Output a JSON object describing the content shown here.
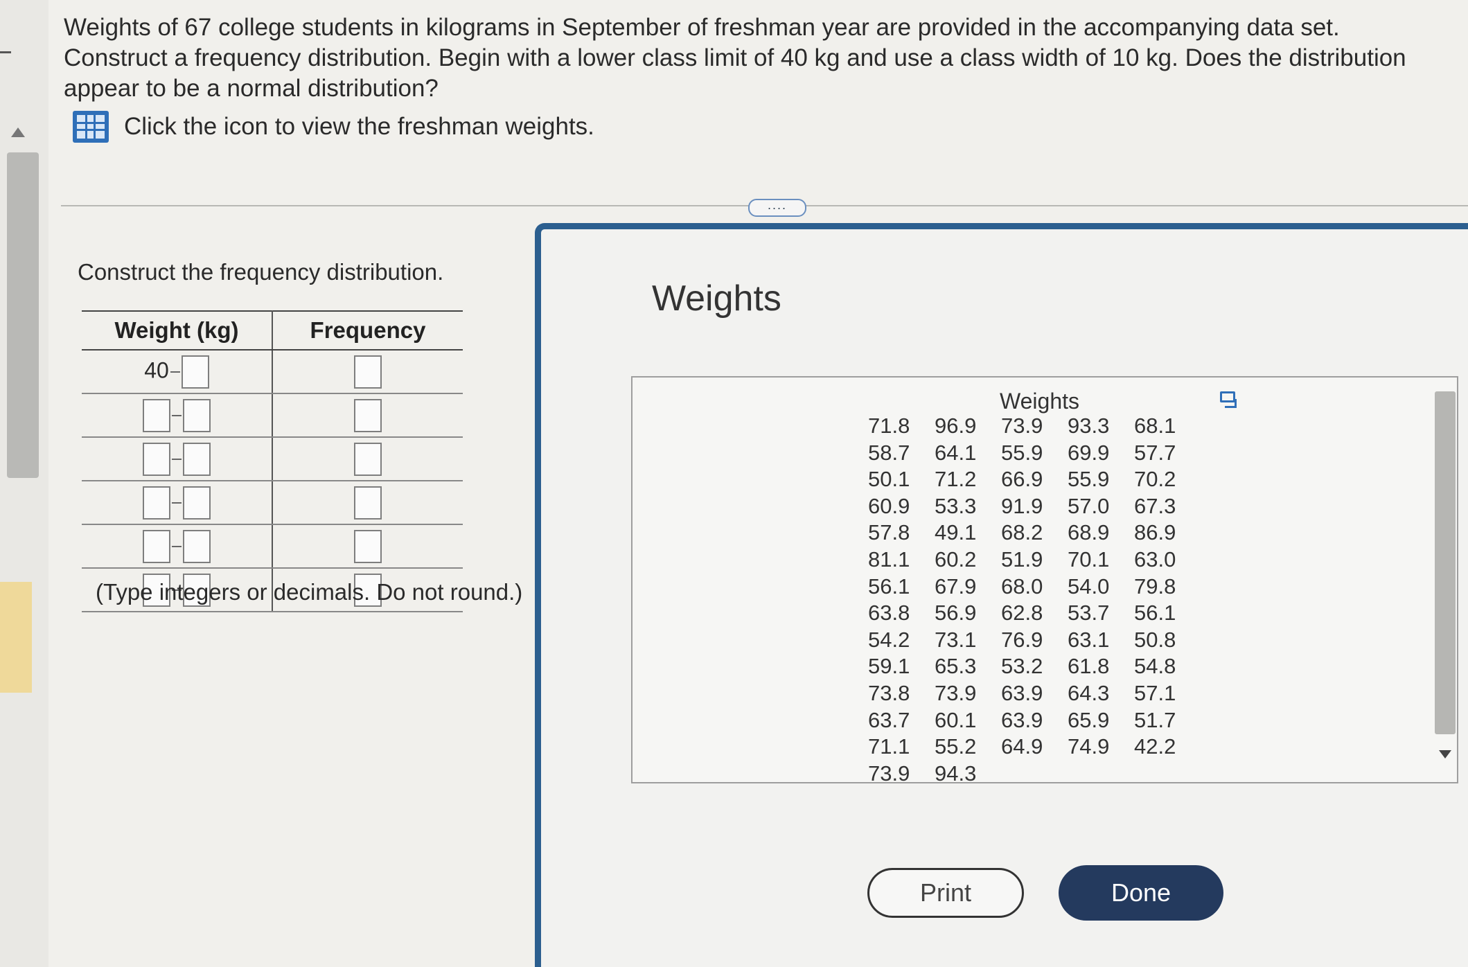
{
  "question": {
    "text": "Weights of 67 college students in kilograms in September of freshman year are provided in the accompanying data set. Construct a frequency distribution. Begin with a lower class limit of 40 kg and use a class width of 10 kg. Does the distribution appear to be a normal distribution?",
    "dataset_link": "Click the icon to view the freshman weights."
  },
  "more_button": "....",
  "frequency_section": {
    "instruction": "Construct the frequency distribution.",
    "headers": [
      "Weight (kg)",
      "Frequency"
    ],
    "first_lower_limit": "40",
    "note": "(Type integers or decimals. Do not round.)"
  },
  "popup": {
    "title": "Weights",
    "table_title": "Weights",
    "values": [
      "71.8",
      "96.9",
      "73.9",
      "93.3",
      "68.1",
      "58.7",
      "64.1",
      "55.9",
      "69.9",
      "57.7",
      "50.1",
      "71.2",
      "66.9",
      "55.9",
      "70.2",
      "60.9",
      "53.3",
      "91.9",
      "57.0",
      "67.3",
      "57.8",
      "49.1",
      "68.2",
      "68.9",
      "86.9",
      "81.1",
      "60.2",
      "51.9",
      "70.1",
      "63.0",
      "56.1",
      "67.9",
      "68.0",
      "54.0",
      "79.8",
      "63.8",
      "56.9",
      "62.8",
      "53.7",
      "56.1",
      "54.2",
      "73.1",
      "76.9",
      "63.1",
      "50.8",
      "59.1",
      "65.3",
      "53.2",
      "61.8",
      "54.8",
      "73.8",
      "73.9",
      "63.9",
      "64.3",
      "57.1",
      "63.7",
      "60.1",
      "63.9",
      "65.9",
      "51.7",
      "71.1",
      "55.2",
      "64.9",
      "74.9",
      "42.2",
      "73.9",
      "94.3"
    ],
    "print_label": "Print",
    "done_label": "Done"
  }
}
